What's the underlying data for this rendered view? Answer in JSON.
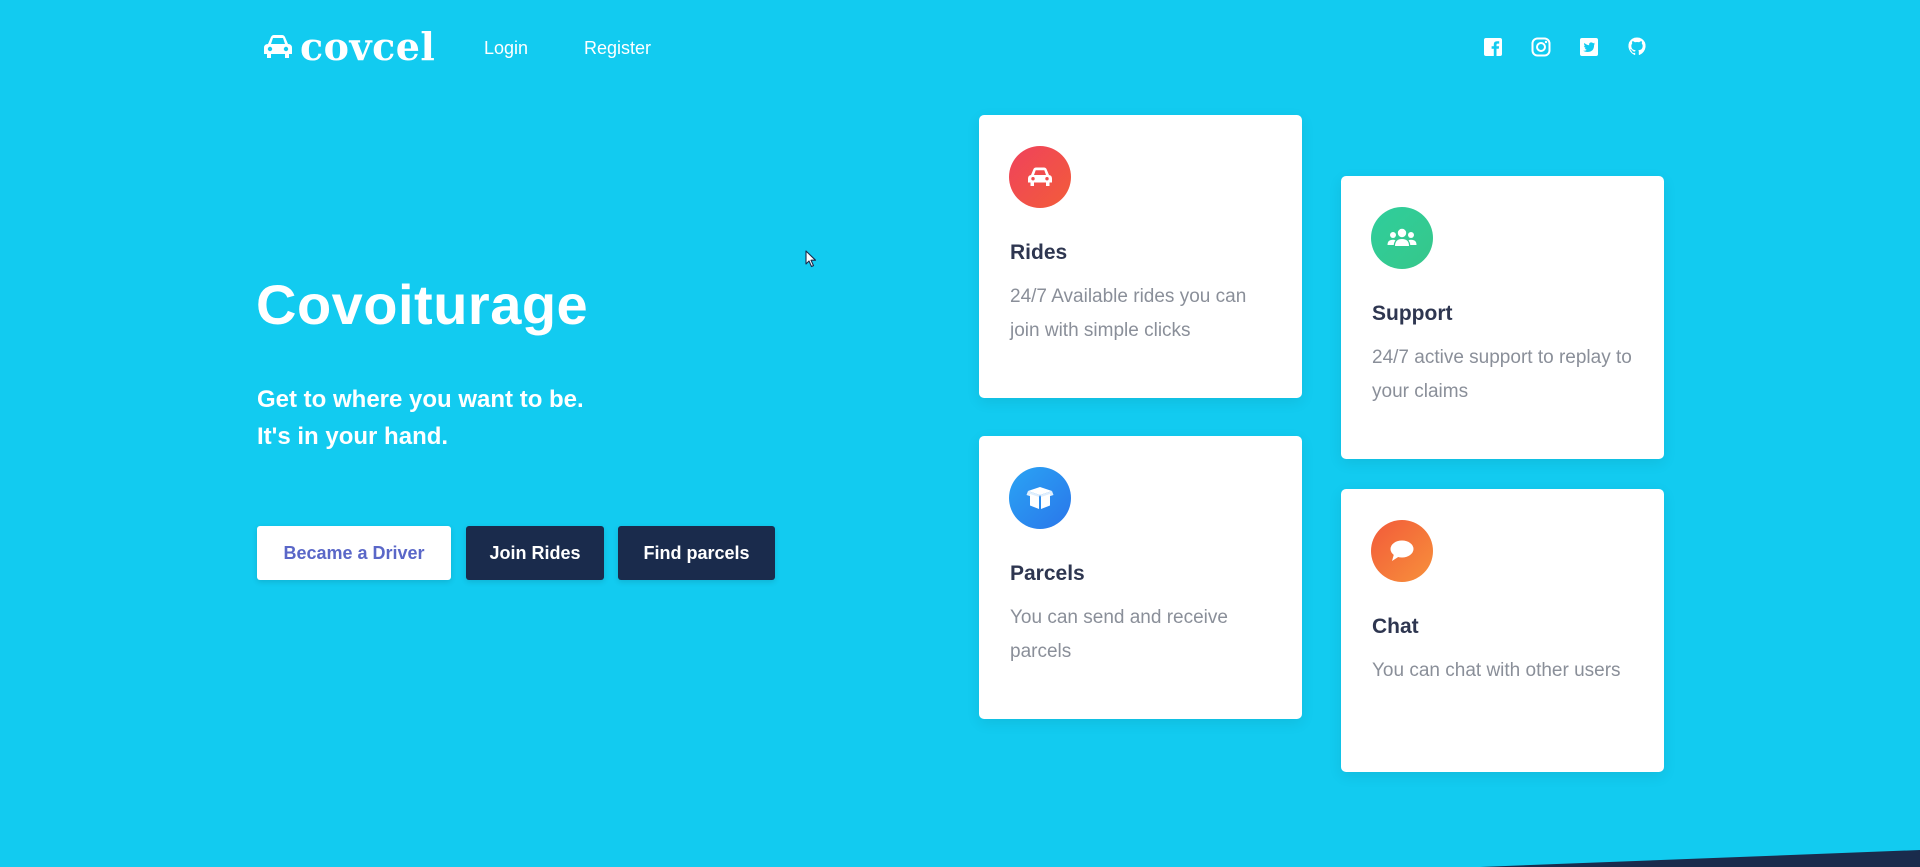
{
  "nav": {
    "logo_text": "covcel",
    "login": "Login",
    "register": "Register",
    "social": [
      "facebook-icon",
      "instagram-icon",
      "twitter-icon",
      "github-icon"
    ]
  },
  "hero": {
    "title": "Covoiturage",
    "subtitle_line1": "Get to where you want to be.",
    "subtitle_line2": "It's in your hand.",
    "buttons": {
      "driver": "Became a Driver",
      "join": "Join Rides",
      "parcels": "Find parcels"
    }
  },
  "cards": {
    "rides": {
      "title": "Rides",
      "text": "24/7 Available rides you can join with simple clicks",
      "icon": "car-icon"
    },
    "support": {
      "title": "Support",
      "text": "24/7 active support to replay to your claims",
      "icon": "users-icon"
    },
    "parcels": {
      "title": "Parcels",
      "text": "You can send and receive parcels",
      "icon": "box-icon"
    },
    "chat": {
      "title": "Chat",
      "text": "You can chat with other users",
      "icon": "chat-bubble-icon"
    }
  },
  "colors": {
    "background": "#12cbf0",
    "button_dark": "#1a2b4c",
    "button_light_text": "#5a67c8",
    "card_title": "#2e3650",
    "card_text": "#8a8f99"
  }
}
